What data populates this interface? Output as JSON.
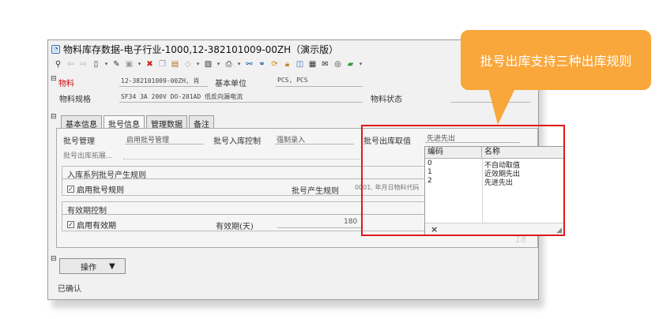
{
  "window": {
    "title": "物料库存数据-电子行业-1000,12-382101009-00ZH（演示版）"
  },
  "toolbar": {
    "icons": [
      "search-icon",
      "back-arrow-icon",
      "forward-arrow-icon",
      "new-document-icon",
      "edit-icon",
      "save-icon",
      "delete-icon",
      "copy-icon",
      "paste-icon",
      "eraser-icon",
      "print-icon",
      "tree-icon",
      "link-icon",
      "refresh-icon",
      "lock-icon",
      "chart-icon",
      "calculator-icon",
      "mail-icon",
      "comment-icon",
      "export-icon"
    ]
  },
  "header": {
    "material_label": "物料",
    "material_value": "12-382101009-00ZH, 肖",
    "base_unit_label": "基本单位",
    "base_unit_value": "PCS, PCS",
    "spec_label": "物料规格",
    "spec_value": "SF34 3A 200V DO-201AD  低反向漏电流",
    "status_label": "物料状态"
  },
  "tabs": [
    {
      "label": "基本信息"
    },
    {
      "label": "批号信息"
    },
    {
      "label": "管理数据"
    },
    {
      "label": "备注"
    }
  ],
  "batch": {
    "mgmt_label": "批号管理",
    "mgmt_value": "启用批号管理",
    "entry_ctrl_label": "批号入库控制",
    "entry_ctrl_value": "强制录入",
    "out_value_label": "批号出库取值",
    "out_value_current": "先进先出",
    "out_expand_label": "批号出库拓展...",
    "rule_section_label": "入库系列批号产生规则",
    "enable_rule_label": "启用批号规则",
    "gen_rule_label": "批号产生规则",
    "gen_rule_value": "0001, 年月日物料代码",
    "expiry_section_label": "有效期控制",
    "enable_expiry_label": "启用有效期",
    "expiry_days_label": "有效期(天)",
    "expiry_days_value": "180"
  },
  "dropdown": {
    "col_code": "编码",
    "col_name": "名称",
    "rows": [
      {
        "code": "0",
        "name": "不自动取值"
      },
      {
        "code": "1",
        "name": "近效期先出"
      },
      {
        "code": "2",
        "name": "先进先出"
      }
    ],
    "close_glyph": "×"
  },
  "footer": {
    "operate_label": "操作",
    "status_text": "已确认"
  },
  "callout": {
    "text": "批号出库支持三种出库规则"
  },
  "colors": {
    "highlight": "#e01a1a",
    "callout": "#f9a63a",
    "material_label": "#cc1010"
  }
}
